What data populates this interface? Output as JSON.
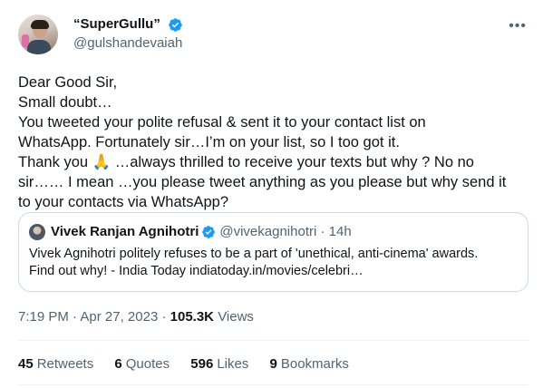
{
  "author": {
    "display_name": "“SuperGullu”",
    "handle": "@gulshandevaiah",
    "verified_color": "#1d9bf0"
  },
  "tweet": {
    "text": "Dear Good Sir,\nSmall doubt…\nYou tweeted your polite refusal & sent it to your contact list on\nWhatsApp. Fortunately sir…I’m on your list, so I too got it.\nThank you 🙏 …always thrilled to receive your texts but why ? No no\nsir…… I mean …you please tweet anything as you please but why send it\nto your contacts via WhatsApp?"
  },
  "quote": {
    "name": "Vivek Ranjan Agnihotri",
    "handle": "@vivekagnihotri",
    "separator": "·",
    "time": "14h",
    "text": "Vivek Agnihotri politely refuses to be a part of 'unethical, anti-cinema' awards.\nFind out why! - India Today indiatoday.in/movies/celebri…"
  },
  "meta": {
    "time": "7:19 PM",
    "sep1": "·",
    "date": "Apr 27, 2023",
    "sep2": "·",
    "views_count": "105.3K",
    "views_label": "Views"
  },
  "stats": {
    "retweets_count": "45",
    "retweets_label": "Retweets",
    "quotes_count": "6",
    "quotes_label": "Quotes",
    "likes_count": "596",
    "likes_label": "Likes",
    "bookmarks_count": "9",
    "bookmarks_label": "Bookmarks"
  },
  "icons": {
    "more": "more-horizontal-icon",
    "verified": "verified-badge-icon"
  }
}
